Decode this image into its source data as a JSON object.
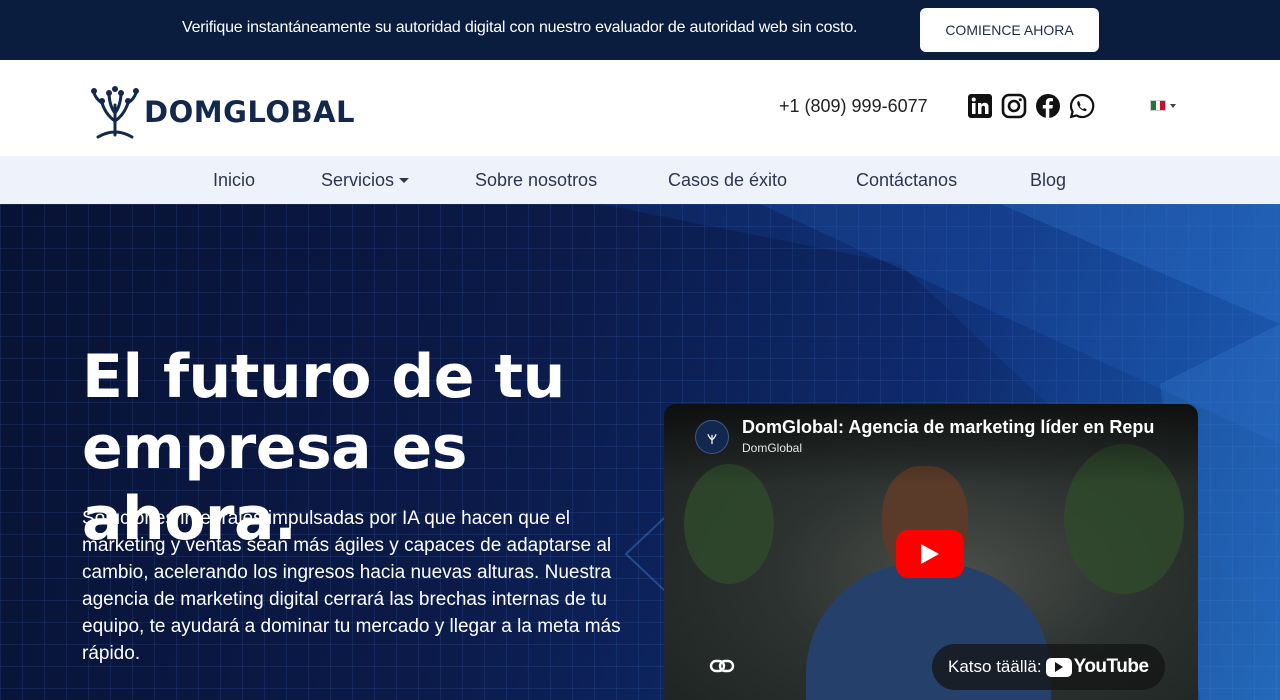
{
  "promo": {
    "text": "Verifique instantáneamente su autoridad digital con nuestro evaluador de autoridad web sin costo.",
    "button": "COMIENCE AHORA"
  },
  "header": {
    "logo_text": "DOMGLOBAL",
    "phone": "+1 (809) 999-6077",
    "social_icons": [
      "linkedin-icon",
      "instagram-icon",
      "facebook-icon",
      "whatsapp-icon"
    ],
    "language_flag": "mexico-flag-icon"
  },
  "nav": {
    "items": [
      {
        "label": "Inicio"
      },
      {
        "label": "Servicios"
      },
      {
        "label": "Sobre nosotros"
      },
      {
        "label": "Casos de éxito"
      },
      {
        "label": "Contáctanos"
      },
      {
        "label": "Blog"
      }
    ]
  },
  "hero": {
    "title": "El futuro de tu empresa es ahora.",
    "description": "Soluciones integrales impulsadas por IA que hacen que el marketing y ventas sean más ágiles y capaces de adaptarse al cambio, acelerando los ingresos hacia nuevas alturas. Nuestra agencia de marketing digital cerrará las brechas internas de tu equipo, te ayudará a dominar tu mercado y llegar a la meta más rápido."
  },
  "video": {
    "title": "DomGlobal: Agencia de marketing líder en Repu",
    "channel": "DomGlobal",
    "watch_label": "Katso täällä:",
    "platform": "YouTube"
  },
  "colors": {
    "promo_bg": "#0b1d3f",
    "brand_navy": "#13284d",
    "nav_bg": "#eef2fa",
    "play_red": "#ff0000"
  }
}
